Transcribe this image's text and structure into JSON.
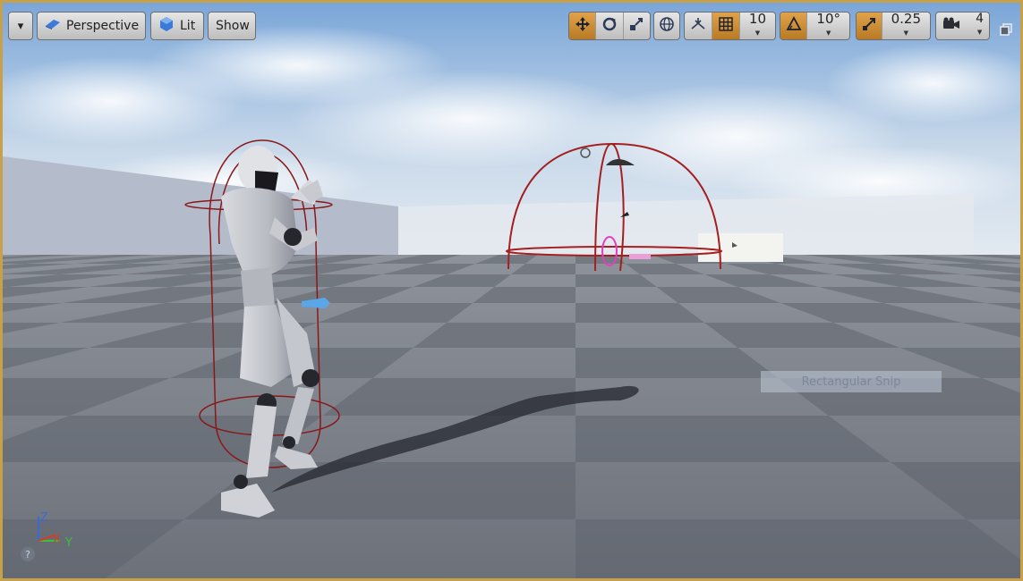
{
  "toolbar": {
    "menu_arrow": "▾",
    "view_mode_label": "Perspective",
    "lighting_label": "Lit",
    "show_label": "Show",
    "grid_snap_value": "10",
    "rotation_snap_value": "10°",
    "scale_snap_value": "0.25",
    "camera_speed_value": "4"
  },
  "overlay": {
    "snip_label": "Rectangular Snip"
  },
  "axis_widget": {
    "z_label": "Z",
    "x_label": "X",
    "y_label": "Y"
  },
  "help_label": "?",
  "colors": {
    "active_accent": "#d08c2e",
    "viewport_border": "#c8a04a",
    "axis_x": "#d83a2a",
    "axis_y": "#3ac23a",
    "axis_z": "#3a6ad8",
    "debug_shape": "#a42020"
  },
  "icons": {
    "view_mode": "perspective-cube-icon",
    "lighting": "lit-sphere-icon",
    "translate": "translate-arrows-icon",
    "rotate": "rotate-icon",
    "scale": "scale-icon",
    "world_local": "globe-icon",
    "surface_snap": "surface-snap-icon",
    "grid_snap": "grid-icon",
    "rotation_snap": "angle-icon",
    "scale_snap": "scale-arrow-icon",
    "camera_speed": "camera-icon",
    "restore": "restore-window-icon"
  }
}
